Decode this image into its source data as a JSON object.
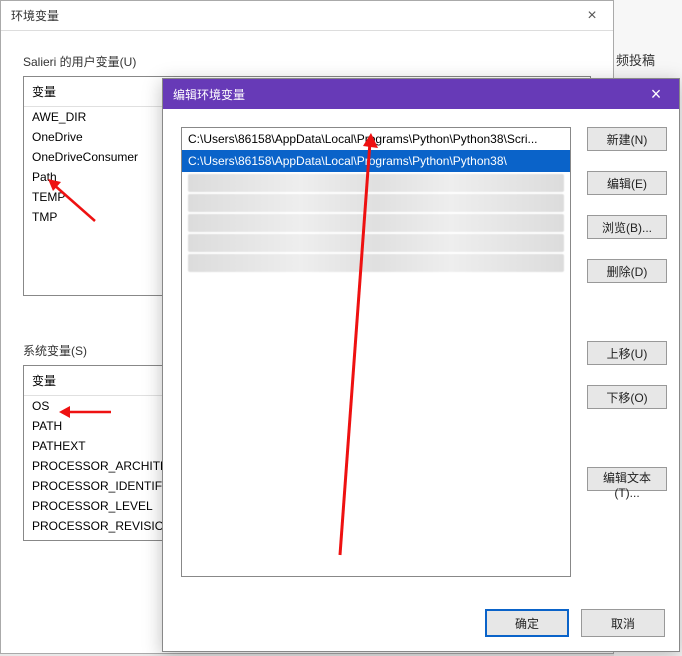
{
  "env_window": {
    "title": "环境变量",
    "user_section_label": "Salieri 的用户变量(U)",
    "user_header": "变量",
    "user_vars": [
      "AWE_DIR",
      "OneDrive",
      "OneDriveConsumer",
      "Path",
      "TEMP",
      "TMP"
    ],
    "sys_section_label": "系统变量(S)",
    "sys_header": "变量",
    "sys_vars": [
      "OS",
      "PATH",
      "PATHEXT",
      "PROCESSOR_ARCHITE",
      "PROCESSOR_IDENTIFI",
      "PROCESSOR_LEVEL",
      "PROCESSOR_REVISIO"
    ]
  },
  "right_strip_text": "频投稿",
  "modal": {
    "title": "编辑环境变量",
    "values": [
      {
        "text": "C:\\Users\\86158\\AppData\\Local\\Programs\\Python\\Python38\\Scri...",
        "selected": false,
        "blurred": false
      },
      {
        "text": "C:\\Users\\86158\\AppData\\Local\\Programs\\Python\\Python38\\",
        "selected": true,
        "blurred": false
      },
      {
        "text": "",
        "selected": false,
        "blurred": true
      },
      {
        "text": "",
        "selected": false,
        "blurred": true
      },
      {
        "text": "",
        "selected": false,
        "blurred": true
      },
      {
        "text": "",
        "selected": false,
        "blurred": true
      },
      {
        "text": "",
        "selected": false,
        "blurred": true
      }
    ],
    "buttons": {
      "new": "新建(N)",
      "edit": "编辑(E)",
      "browse": "浏览(B)...",
      "delete": "删除(D)",
      "move_up": "上移(U)",
      "move_down": "下移(O)",
      "edit_text": "编辑文本(T)...",
      "ok": "确定",
      "cancel": "取消"
    }
  }
}
